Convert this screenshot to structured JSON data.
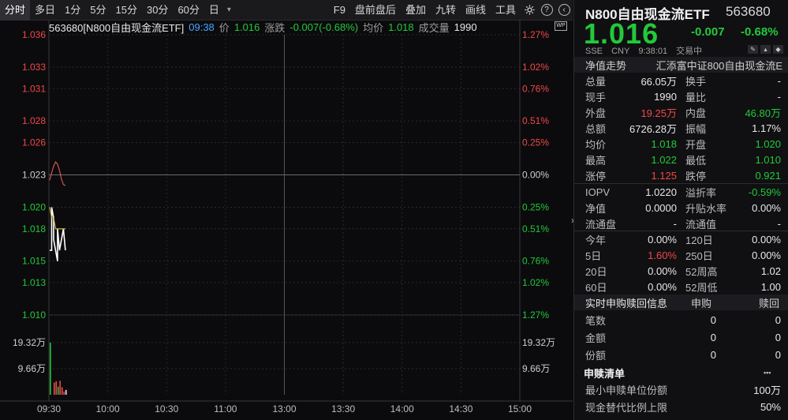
{
  "toolbar": {
    "items": [
      "分时",
      "多日",
      "1分",
      "5分",
      "15分",
      "30分",
      "60分",
      "日"
    ],
    "dropdown": "▾",
    "right_items": [
      "F9",
      "盘前盘后",
      "叠加",
      "九转",
      "画线",
      "工具"
    ]
  },
  "infoline": {
    "code_name": "563680[N800自由现金流ETF]",
    "time": "09:38",
    "price_label": "价",
    "price": "1.016",
    "change_label": "涨跌",
    "change": "-0.007(-0.68%)",
    "avg_label": "均价",
    "avg": "1.018",
    "volume_label": "成交量",
    "volume": "1990"
  },
  "badge": "WP",
  "chart_data": {
    "type": "line",
    "price_ticks": [
      "1.036",
      "1.033",
      "1.031",
      "1.028",
      "1.026",
      "1.023",
      "1.020",
      "1.018",
      "1.015",
      "1.013",
      "1.010"
    ],
    "pct_ticks": [
      "1.27%",
      "1.02%",
      "0.76%",
      "0.51%",
      "0.25%",
      "0.00%",
      "0.25%",
      "0.51%",
      "0.76%",
      "1.02%",
      "1.27%"
    ],
    "volume_ticks": [
      "19.32万",
      "9.66万"
    ],
    "x_ticks": [
      "09:30",
      "10:00",
      "10:30",
      "11:00",
      "13:00",
      "13:30",
      "14:00",
      "14:30",
      "15:00"
    ],
    "ylim": [
      1.01,
      1.036
    ],
    "prev_close": 1.023,
    "minutes": 240,
    "series": [
      {
        "name": "价",
        "color": "#ffffff",
        "x": [
          0,
          1,
          1,
          2,
          2,
          3,
          4,
          4,
          5,
          6,
          7,
          8,
          8
        ],
        "values": [
          1.016,
          1.016,
          1.02,
          1.019,
          1.017,
          1.016,
          1.015,
          1.018,
          1.016,
          1.017,
          1.018,
          1.016,
          1.016
        ]
      },
      {
        "name": "均价",
        "color": "#e0c040",
        "x": [
          0,
          1,
          2,
          3,
          4,
          5,
          6,
          7,
          8
        ],
        "values": [
          1.02,
          1.019,
          1.019,
          1.018,
          1.018,
          1.018,
          1.018,
          1.018,
          1.018
        ]
      },
      {
        "name": "IOPV",
        "color": "#e05a5a",
        "x": [
          0,
          1,
          2,
          3,
          4,
          5,
          6,
          7,
          8
        ],
        "values": [
          1.0225,
          1.0232,
          1.0238,
          1.0242,
          1.024,
          1.0234,
          1.0226,
          1.0221,
          1.022
        ]
      }
    ],
    "volume_series": [
      {
        "x": 0,
        "value": 19.3,
        "color": "#22c93b"
      },
      {
        "x": 2,
        "value": 4.5,
        "color": "#f04848"
      },
      {
        "x": 3,
        "value": 5.0,
        "color": "#f04848"
      },
      {
        "x": 4,
        "value": 3.0,
        "color": "#22c93b"
      },
      {
        "x": 5,
        "value": 5.2,
        "color": "#f04848"
      },
      {
        "x": 6,
        "value": 2.8,
        "color": "#f04848"
      },
      {
        "x": 7,
        "value": 1.2,
        "color": "#f04848"
      },
      {
        "x": 8,
        "value": 1.8,
        "color": "#e8e8e8"
      }
    ],
    "volume_max": 19.32
  },
  "panel": {
    "title": "N800自由现金流ETF",
    "code": "563680",
    "price": "1.016",
    "change": "-0.007",
    "change_pct": "-0.68%",
    "meta": [
      "SSE",
      "CNY",
      "9:38:01",
      "交易中"
    ],
    "nav_header_left": "净值走势",
    "nav_header_right": "汇添富中证800自由现金流E",
    "rows1": [
      {
        "l": "总量",
        "lv": "66.05万",
        "lc": "#e8e8e8",
        "r": "换手",
        "rv": "-",
        "rc": "#e8e8e8"
      },
      {
        "l": "现手",
        "lv": "1990",
        "lc": "#e8e8e8",
        "r": "量比",
        "rv": "-",
        "rc": "#e8e8e8"
      },
      {
        "l": "外盘",
        "lv": "19.25万",
        "lc": "#f04848",
        "r": "内盘",
        "rv": "46.80万",
        "rc": "#22c93b"
      },
      {
        "l": "总额",
        "lv": "6726.28万",
        "lc": "#e8e8e8",
        "r": "振幅",
        "rv": "1.17%",
        "rc": "#e8e8e8"
      },
      {
        "l": "均价",
        "lv": "1.018",
        "lc": "#22c93b",
        "r": "开盘",
        "rv": "1.020",
        "rc": "#22c93b"
      },
      {
        "l": "最高",
        "lv": "1.022",
        "lc": "#22c93b",
        "r": "最低",
        "rv": "1.010",
        "rc": "#22c93b"
      },
      {
        "l": "涨停",
        "lv": "1.125",
        "lc": "#f04848",
        "r": "跌停",
        "rv": "0.921",
        "rc": "#22c93b"
      }
    ],
    "rows2": [
      {
        "l": "IOPV",
        "lv": "1.0220",
        "lc": "#e8e8e8",
        "r": "溢折率",
        "rv": "-0.59%",
        "rc": "#22c93b"
      },
      {
        "l": "净值",
        "lv": "0.0000",
        "lc": "#e8e8e8",
        "r": "升贴水率",
        "rv": "0.00%",
        "rc": "#e8e8e8"
      },
      {
        "l": "流通盘",
        "lv": "-",
        "lc": "#e8e8e8",
        "r": "流通值",
        "rv": "-",
        "rc": "#e8e8e8"
      }
    ],
    "rows3": [
      {
        "l": "今年",
        "lv": "0.00%",
        "lc": "#e8e8e8",
        "r": "120日",
        "rv": "0.00%",
        "rc": "#e8e8e8"
      },
      {
        "l": "5日",
        "lv": "1.60%",
        "lc": "#f04848",
        "r": "250日",
        "rv": "0.00%",
        "rc": "#e8e8e8"
      },
      {
        "l": "20日",
        "lv": "0.00%",
        "lc": "#e8e8e8",
        "r": "52周高",
        "rv": "1.02",
        "rc": "#e8e8e8"
      },
      {
        "l": "60日",
        "lv": "0.00%",
        "lc": "#e8e8e8",
        "r": "52周低",
        "rv": "1.00",
        "rc": "#e8e8e8"
      }
    ],
    "creation_header": [
      "实时申购赎回信息",
      "申购",
      "赎回"
    ],
    "creation_rows": [
      {
        "l": "笔数",
        "a": "0",
        "b": "0"
      },
      {
        "l": "金额",
        "a": "0",
        "b": "0"
      },
      {
        "l": "份额",
        "a": "0",
        "b": "0"
      }
    ],
    "list_title": "申赎清单",
    "list_more": "•••",
    "list_rows": [
      {
        "l": "最小申赎单位份额",
        "v": "100万"
      },
      {
        "l": "现金替代比例上限",
        "v": "50%"
      }
    ]
  }
}
